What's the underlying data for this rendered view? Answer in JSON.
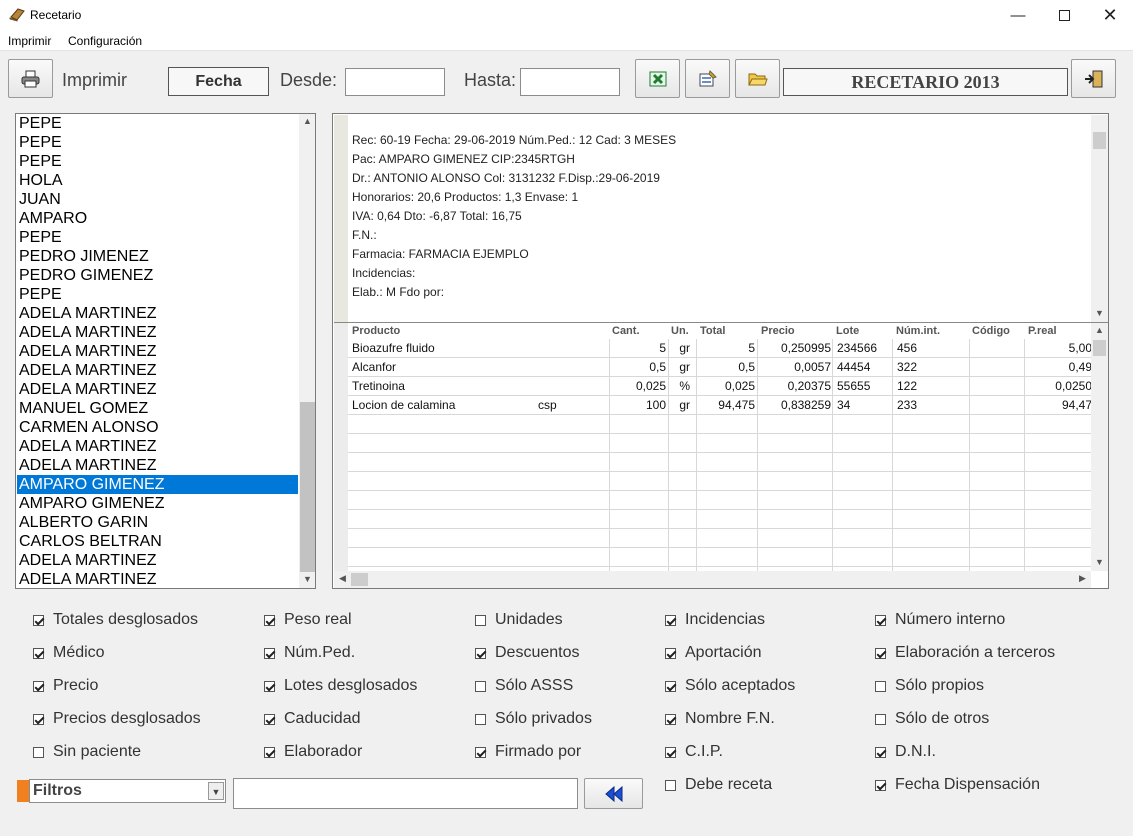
{
  "window": {
    "title": "Recetario"
  },
  "menu": [
    "Imprimir",
    "Configuración"
  ],
  "toolbar": {
    "print_label": "Imprimir",
    "date_field_label": "Fecha",
    "from_label": "Desde:",
    "from_value": "",
    "to_label": "Hasta:",
    "to_value": "",
    "year_title": "RECETARIO 2013"
  },
  "patients": [
    {
      "name": "PEPE",
      "selected": false
    },
    {
      "name": "PEPE",
      "selected": false
    },
    {
      "name": "PEPE",
      "selected": false
    },
    {
      "name": "HOLA",
      "selected": false
    },
    {
      "name": "JUAN",
      "selected": false
    },
    {
      "name": "AMPARO",
      "selected": false
    },
    {
      "name": "PEPE",
      "selected": false
    },
    {
      "name": "PEDRO JIMENEZ",
      "selected": false
    },
    {
      "name": "PEDRO GIMENEZ",
      "selected": false
    },
    {
      "name": "PEPE",
      "selected": false
    },
    {
      "name": "ADELA MARTINEZ",
      "selected": false
    },
    {
      "name": "ADELA MARTINEZ",
      "selected": false
    },
    {
      "name": "ADELA MARTINEZ",
      "selected": false
    },
    {
      "name": "ADELA MARTINEZ",
      "selected": false
    },
    {
      "name": "ADELA MARTINEZ",
      "selected": false
    },
    {
      "name": "MANUEL GOMEZ",
      "selected": false
    },
    {
      "name": "CARMEN ALONSO",
      "selected": false
    },
    {
      "name": "ADELA MARTINEZ",
      "selected": false
    },
    {
      "name": "ADELA MARTINEZ",
      "selected": false
    },
    {
      "name": "AMPARO GIMENEZ",
      "selected": true
    },
    {
      "name": "AMPARO GIMENEZ",
      "selected": false
    },
    {
      "name": "ALBERTO GARIN",
      "selected": false
    },
    {
      "name": "CARLOS BELTRAN",
      "selected": false
    },
    {
      "name": "ADELA MARTINEZ",
      "selected": false
    },
    {
      "name": "ADELA MARTINEZ",
      "selected": false
    }
  ],
  "recipe_info": [
    "Rec: 60-19  Fecha: 29-06-2019  Núm.Ped.: 12  Cad: 3 MESES",
    "Pac: AMPARO GIMENEZ CIP:2345RTGH",
    "Dr.: ANTONIO ALONSO Col: 3131232 F.Disp.:29-06-2019",
    "Honorarios: 20,6  Productos: 1,3  Envase: 1",
    "IVA: 0,64  Dto: -6,87  Total: 16,75",
    "F.N.:",
    "Farmacia: FARMACIA EJEMPLO",
    "Incidencias:",
    "Elab.: M  Fdo por:"
  ],
  "grid": {
    "columns": [
      "Producto",
      "Cant.",
      "Un.",
      "Total",
      "Precio",
      "Lote",
      "Núm.int.",
      "Código",
      "P.real"
    ],
    "rows": [
      {
        "producto": "Bioazufre fluido",
        "extra": "",
        "cant": "5",
        "un": "gr",
        "total": "5",
        "precio": "0,250995",
        "lote": "234566",
        "numint": "456",
        "codigo": "",
        "preal": "5,00"
      },
      {
        "producto": "Alcanfor",
        "extra": "",
        "cant": "0,5",
        "un": "gr",
        "total": "0,5",
        "precio": "0,0057",
        "lote": "44454",
        "numint": "322",
        "codigo": "",
        "preal": "0,49"
      },
      {
        "producto": "Tretinoina",
        "extra": "",
        "cant": "0,025",
        "un": "%",
        "total": "0,025",
        "precio": "0,20375",
        "lote": "55655",
        "numint": "122",
        "codigo": "",
        "preal": "0,0250"
      },
      {
        "producto": "Locion de calamina",
        "extra": "csp",
        "cant": "100",
        "un": "gr",
        "total": "94,475",
        "precio": "0,838259",
        "lote": "34",
        "numint": "233",
        "codigo": "",
        "preal": "94,47"
      }
    ]
  },
  "options": [
    [
      {
        "label": "Totales desglosados",
        "checked": true
      },
      {
        "label": "Médico",
        "checked": true
      },
      {
        "label": "Precio",
        "checked": true
      },
      {
        "label": "Precios desglosados",
        "checked": true
      },
      {
        "label": "Sin paciente",
        "checked": false
      }
    ],
    [
      {
        "label": "Peso real",
        "checked": true
      },
      {
        "label": "Núm.Ped.",
        "checked": true
      },
      {
        "label": "Lotes desglosados",
        "checked": true
      },
      {
        "label": "Caducidad",
        "checked": true
      },
      {
        "label": "Elaborador",
        "checked": true
      }
    ],
    [
      {
        "label": "Unidades",
        "checked": false
      },
      {
        "label": "Descuentos",
        "checked": true
      },
      {
        "label": "Sólo ASSS",
        "checked": false
      },
      {
        "label": "Sólo privados",
        "checked": false
      },
      {
        "label": "Firmado por",
        "checked": true
      }
    ],
    [
      {
        "label": "Incidencias",
        "checked": true
      },
      {
        "label": "Aportación",
        "checked": true
      },
      {
        "label": "Sólo aceptados",
        "checked": true
      },
      {
        "label": "Nombre F.N.",
        "checked": true
      },
      {
        "label": "C.I.P.",
        "checked": true
      },
      {
        "label": "Debe receta",
        "checked": false
      }
    ],
    [
      {
        "label": "Número interno",
        "checked": true
      },
      {
        "label": "Elaboración a terceros",
        "checked": true
      },
      {
        "label": "Sólo propios",
        "checked": false
      },
      {
        "label": "Sólo de otros",
        "checked": false
      },
      {
        "label": "D.N.I.",
        "checked": true
      },
      {
        "label": "Fecha Dispensación",
        "checked": true
      }
    ]
  ],
  "filters": {
    "selected": "Filtros",
    "text_value": ""
  },
  "colors": {
    "selection": "#0078d7",
    "filter_marker": "#f08020",
    "excel_green": "#1e7d32"
  },
  "icons": [
    "printer-icon",
    "excel-icon",
    "settings-icon",
    "open-folder-icon",
    "exit-icon",
    "rewind-icon"
  ]
}
